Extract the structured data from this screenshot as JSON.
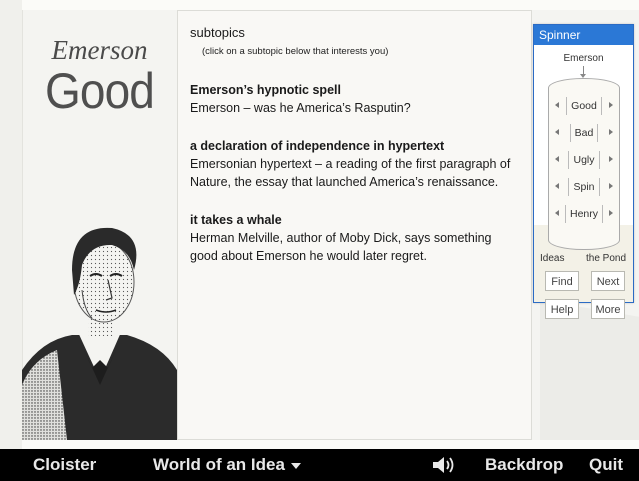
{
  "page": {
    "author_name": "Emerson",
    "section_word": "Good"
  },
  "content": {
    "heading": "subtopics",
    "hint": "(click on a subtopic below that interests you)",
    "topics": [
      {
        "title": "Emerson’s hypnotic spell",
        "desc": "Emerson – was he America’s Rasputin?"
      },
      {
        "title": "a declaration of independence in hypertext",
        "desc": "Emersonian hypertext – a reading of the first paragraph of Nature, the essay that launched America’s renaissance."
      },
      {
        "title": "it takes a whale",
        "desc": "Herman Melville, author of Moby Dick, says something good about Emerson he would later regret."
      }
    ]
  },
  "spinner": {
    "title": "Spinner",
    "caption": "Emerson",
    "items": [
      "Good",
      "Bad",
      "Ugly",
      "Spin",
      "Henry"
    ],
    "left_label": "Ideas",
    "right_label": "the Pond",
    "buttons": {
      "find": "Find",
      "next": "Next",
      "help": "Help",
      "more": "More"
    }
  },
  "bottombar": {
    "cloister": "Cloister",
    "world": "World of an Idea",
    "backdrop": "Backdrop",
    "quit": "Quit",
    "icons": {
      "dropdown": "chevron-down-icon",
      "sound": "speaker-icon"
    }
  },
  "colors": {
    "accent": "#2b78d6",
    "bar": "#000000"
  }
}
